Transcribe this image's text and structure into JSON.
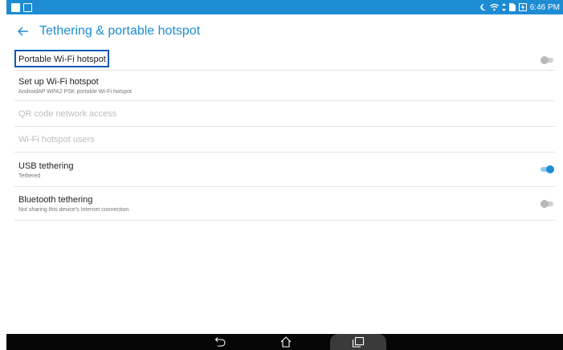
{
  "status_bar": {
    "time": "6:46 PM",
    "icons": [
      "notification-icon",
      "image-icon",
      "moon-icon",
      "wifi-icon",
      "data-arrows-icon",
      "sim-icon",
      "battery-charging-icon"
    ]
  },
  "app_bar": {
    "back_icon": "arrow-left-icon",
    "title": "Tethering & portable hotspot"
  },
  "settings": {
    "portable_hotspot": {
      "title": "Portable Wi-Fi hotspot",
      "toggle_on": false
    },
    "setup_hotspot": {
      "title": "Set up Wi-Fi hotspot",
      "summary": "AndroidAP WPA2 PSK portable Wi-Fi hotspot"
    },
    "qr_code": {
      "title": "QR code network access",
      "enabled": false
    },
    "hotspot_users": {
      "title": "Wi-Fi hotspot users",
      "enabled": false
    },
    "usb_tethering": {
      "title": "USB tethering",
      "summary": "Tethered",
      "toggle_on": true
    },
    "bluetooth_tethering": {
      "title": "Bluetooth tethering",
      "summary": "Not sharing this device's Internet connection",
      "toggle_on": false
    }
  },
  "nav_bar": {
    "buttons": [
      "back-icon",
      "home-icon",
      "recent-apps-icon"
    ]
  },
  "colors": {
    "accent": "#1e8cd2",
    "highlight_border": "#0a58b8",
    "disabled_text": "#bdbdbd"
  }
}
